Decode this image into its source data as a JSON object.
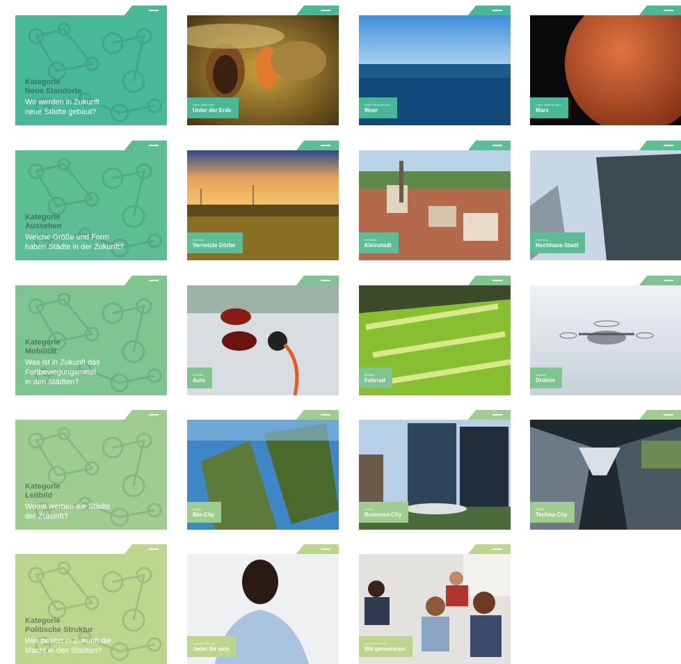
{
  "colors": {
    "row1": "#48b896",
    "row2": "#5dbd94",
    "row3": "#7ec592",
    "row4": "#9fcd90",
    "row5": "#bcd68d"
  },
  "rows": [
    {
      "category": {
        "label": "Kategorie",
        "name": "Neue Standorte",
        "question": "Wo werden in Zukunft\nneue Städte gebaut?"
      },
      "cards": [
        {
          "tag": "Unser Stadt unter",
          "title": "Unter der Erde",
          "image": "cave"
        },
        {
          "tag": "Unser Stadt auf dem",
          "title": "Meer",
          "image": "sea"
        },
        {
          "tag": "Unser Stadt auf dem",
          "title": "Mars",
          "image": "mars"
        }
      ]
    },
    {
      "category": {
        "label": "Kategorie",
        "name": "Aussehen",
        "question": "Welche Größe und Form\nhaben Städte in der Zukunft?"
      },
      "cards": [
        {
          "tag": "Vernetzte",
          "title": "Vernetzte Dörfer",
          "image": "sunset-fields"
        },
        {
          "tag": "Kleinstadt",
          "title": "Kleinstadt",
          "image": "town"
        },
        {
          "tag": "Hochhaus",
          "title": "Hochhaus-Stadt",
          "image": "skyscraper"
        }
      ]
    },
    {
      "category": {
        "label": "Kategorie",
        "name": "Mobilität",
        "question": "Was ist in Zukunft das\nFortbewegungsmittel\nin den Städten?"
      },
      "cards": [
        {
          "tag": "Mobilität",
          "title": "Auto",
          "image": "car"
        },
        {
          "tag": "Mobilität",
          "title": "Fahrrad",
          "image": "bikes"
        },
        {
          "tag": "Mobilität",
          "title": "Drohne",
          "image": "drone"
        }
      ]
    },
    {
      "category": {
        "label": "Kategorie",
        "name": "Leitbild",
        "question": "Womit werben die Städte\nder Zukunft?"
      },
      "cards": [
        {
          "tag": "Leitbild",
          "title": "Bio-City",
          "image": "bio-tower"
        },
        {
          "tag": "Leitbild",
          "title": "Business-City",
          "image": "business"
        },
        {
          "tag": "Leitbild",
          "title": "Techno-City",
          "image": "glass-roof"
        }
      ]
    },
    {
      "category": {
        "label": "Kategorie",
        "name": "Politische Struktur",
        "question": "Wer besitzt in Zukunft die\nMacht in den Städten?"
      },
      "cards": [
        {
          "tag": "Politische Struktur",
          "title": "Jeder für sich",
          "image": "person"
        },
        {
          "tag": "Politische Struktur",
          "title": "Wir gemeinsam",
          "image": "group"
        }
      ]
    }
  ]
}
